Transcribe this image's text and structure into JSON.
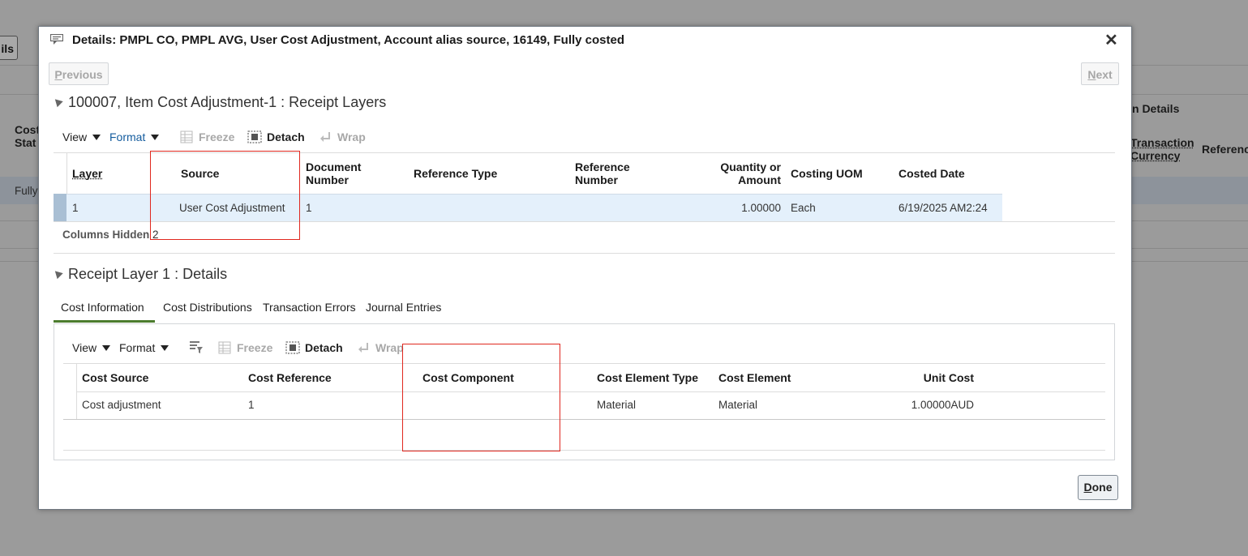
{
  "background": {
    "left_button": "ils",
    "left_col_header_1": "Cost",
    "left_col_header_2": "Stat",
    "left_row_value": "Fully",
    "right_section_title": "n Details",
    "right_col_header_1a": "Transaction",
    "right_col_header_1b": "Currency",
    "right_col_header_2": "Referenc"
  },
  "dialog": {
    "title": "Details: PMPL CO, PMPL AVG, User Cost Adjustment, Account alias source, 16149, Fully costed",
    "close_glyph": "✕",
    "previous_label_first": "P",
    "previous_label_rest": "revious",
    "next_label_first": "N",
    "next_label_rest": "ext",
    "done_label_first": "D",
    "done_label_rest": "one"
  },
  "receipt_layers": {
    "title": "100007, Item Cost Adjustment-1 : Receipt Layers",
    "toolbar": {
      "view": "View",
      "format": "Format",
      "freeze": "Freeze",
      "detach": "Detach",
      "wrap": "Wrap"
    },
    "columns": {
      "layer": "Layer",
      "source": "Source",
      "document_number_1": "Document",
      "document_number_2": "Number",
      "reference_type": "Reference Type",
      "reference_number_1": "Reference",
      "reference_number_2": "Number",
      "quantity_1": "Quantity or",
      "quantity_2": "Amount",
      "costing_uom": "Costing UOM",
      "costed_date": "Costed Date"
    },
    "row": {
      "layer": "1",
      "source": "User Cost Adjustment",
      "document_number": "1",
      "reference_type": "",
      "reference_number": "",
      "quantity": "1.00000",
      "costing_uom": "Each",
      "costed_date": "6/19/2025 AM2:24"
    },
    "columns_hidden_label": "Columns Hidden",
    "columns_hidden_count": "2"
  },
  "layer_details": {
    "title": "Receipt Layer 1 : Details",
    "tabs": [
      "Cost Information",
      "Cost Distributions",
      "Transaction Errors",
      "Journal Entries"
    ],
    "toolbar": {
      "view": "View",
      "format": "Format",
      "freeze": "Freeze",
      "detach": "Detach",
      "wrap": "Wrap"
    },
    "columns": {
      "cost_source": "Cost Source",
      "cost_reference": "Cost Reference",
      "cost_component": "Cost Component",
      "cost_element_type": "Cost Element Type",
      "cost_element": "Cost Element",
      "unit_cost": "Unit Cost"
    },
    "row": {
      "cost_source": "Cost adjustment",
      "cost_reference": "1",
      "cost_component": "",
      "cost_element_type": "Material",
      "cost_element": "Material",
      "unit_cost": "1.00000AUD"
    }
  },
  "colors": {
    "overlay": "#9b9b9b",
    "selected_row": "#e4f0fb",
    "annotation_box": "#e0281f",
    "active_tab_underline": "#4c7c2e",
    "link_blue": "#145c9e"
  }
}
